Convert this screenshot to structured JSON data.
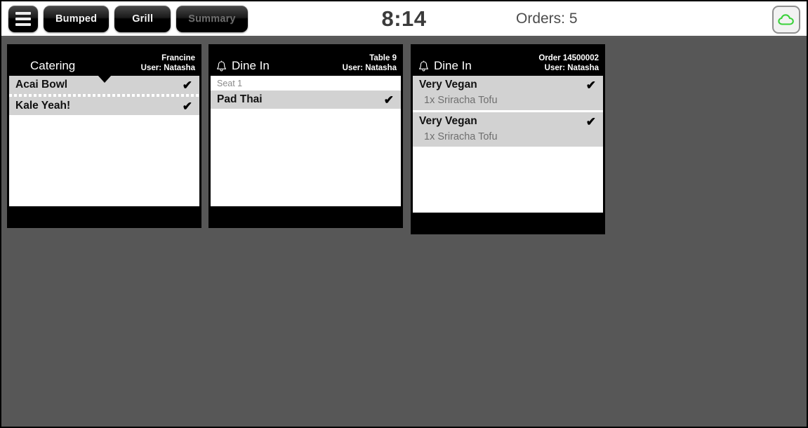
{
  "toolbar": {
    "menu_icon": "hamburger-menu-icon",
    "buttons": [
      {
        "label": "Bumped",
        "state": "enabled"
      },
      {
        "label": "Grill",
        "state": "enabled"
      },
      {
        "label": "Summary",
        "state": "disabled"
      }
    ],
    "clock": "8:14",
    "orders_label": "Orders: 5",
    "cloud_icon": "cloud-icon",
    "cloud_color": "#3ad23a"
  },
  "board": {
    "background_color": "#575757",
    "cards": [
      {
        "id": "card-catering",
        "header": {
          "title": "Catering",
          "has_bell": false,
          "has_caret": true,
          "ref": "Francine",
          "user": "User: Natasha"
        },
        "seat": null,
        "items": [
          {
            "name": "Acai Bowl",
            "check": "✔",
            "mods": []
          },
          {
            "name": "Kale Yeah!",
            "check": "✔",
            "mods": []
          }
        ],
        "separator": "dotted"
      },
      {
        "id": "card-table-9",
        "header": {
          "title": "Dine In",
          "has_bell": true,
          "has_caret": false,
          "ref": "Table 9",
          "user": "User: Natasha"
        },
        "seat": "Seat 1",
        "items": [
          {
            "name": "Pad Thai",
            "check": "✔",
            "mods": []
          }
        ],
        "separator": "none"
      },
      {
        "id": "card-order-14500002",
        "header": {
          "title": "Dine In",
          "has_bell": true,
          "has_caret": false,
          "ref": "Order 14500002",
          "user": "User: Natasha"
        },
        "seat": null,
        "items": [
          {
            "name": "Very Vegan",
            "check": "✔",
            "mods": [
              "1x Sriracha Tofu"
            ]
          },
          {
            "name": "Very Vegan",
            "check": "✔",
            "mods": [
              "1x Sriracha Tofu"
            ]
          }
        ],
        "separator": "white"
      }
    ]
  }
}
